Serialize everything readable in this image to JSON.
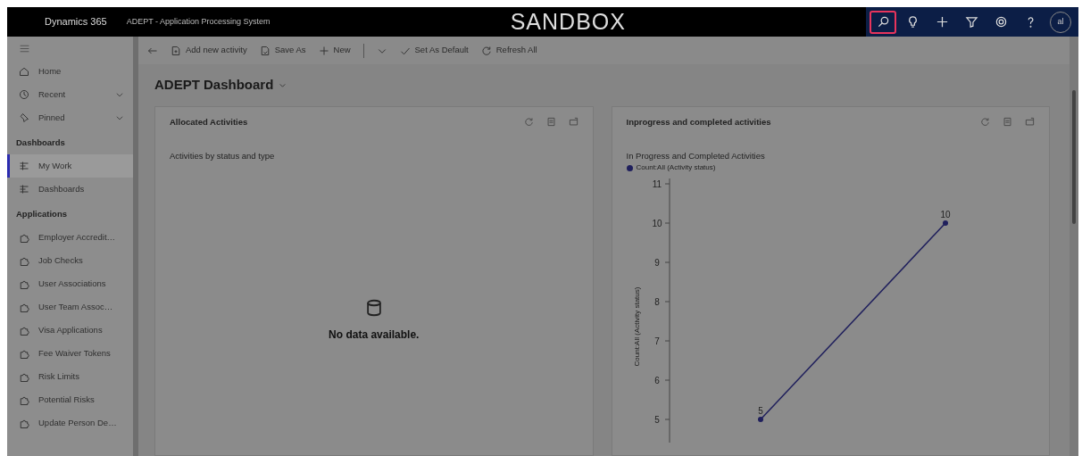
{
  "header": {
    "app_name": "Dynamics 365",
    "app_title": "ADEPT - Application Processing System",
    "environment": "SANDBOX",
    "icons": [
      {
        "kind": "search",
        "highlighted": true
      },
      {
        "kind": "bulb",
        "highlighted": false
      },
      {
        "kind": "plus",
        "highlighted": false
      },
      {
        "kind": "filter",
        "highlighted": false
      },
      {
        "kind": "gear",
        "highlighted": false
      },
      {
        "kind": "help",
        "highlighted": false
      }
    ],
    "avatar": {
      "initials": "al"
    }
  },
  "sidebar": {
    "top_items": [
      {
        "label": "Home",
        "kind": "home",
        "expandable": false
      },
      {
        "label": "Recent",
        "kind": "recent",
        "expandable": true
      },
      {
        "label": "Pinned",
        "kind": "pin",
        "expandable": true
      }
    ],
    "sections": [
      {
        "heading": "Dashboards",
        "items": [
          {
            "label": "My Work",
            "kind": "dashboard",
            "selected": true
          },
          {
            "label": "Dashboards",
            "kind": "dashboard",
            "selected": false
          }
        ]
      },
      {
        "heading": "Applications",
        "items": [
          {
            "label": "Employer Accredit…",
            "kind": "entity",
            "selected": false
          },
          {
            "label": "Job Checks",
            "kind": "entity",
            "selected": false
          },
          {
            "label": "User Associations",
            "kind": "entity",
            "selected": false
          },
          {
            "label": "User Team Assoc…",
            "kind": "entity",
            "selected": false
          },
          {
            "label": "Visa Applications",
            "kind": "entity",
            "selected": false
          },
          {
            "label": "Fee Waiver Tokens",
            "kind": "entity",
            "selected": false
          },
          {
            "label": "Risk Limits",
            "kind": "entity",
            "selected": false
          },
          {
            "label": "Potential Risks",
            "kind": "entity",
            "selected": false
          },
          {
            "label": "Update Person De…",
            "kind": "entity",
            "selected": false
          }
        ]
      }
    ]
  },
  "toolbar": [
    {
      "kind": "back"
    },
    {
      "kind": "add-activity",
      "label": "Add new activity"
    },
    {
      "kind": "save-as",
      "label": "Save As"
    },
    {
      "kind": "new",
      "label": "New"
    },
    {
      "kind": "separator"
    },
    {
      "kind": "dropdown"
    },
    {
      "kind": "set-default",
      "label": "Set As Default"
    },
    {
      "kind": "refresh",
      "label": "Refresh All"
    }
  ],
  "dashboard": {
    "title": "ADEPT Dashboard",
    "cards": [
      {
        "title": "Allocated Activities",
        "subtitle": "Activities by status and type",
        "empty_message": "No data available."
      },
      {
        "title": "Inprogress and completed activities",
        "chart": {
          "title": "In Progress and Completed Activities",
          "legend": "Count:All (Activity status)",
          "ylabel": "Count:All (Activity status)",
          "yticks": [
            "11",
            "10",
            "9",
            "8",
            "7",
            "6",
            "5"
          ],
          "point_labels": [
            "5",
            "10"
          ]
        }
      }
    ]
  }
}
